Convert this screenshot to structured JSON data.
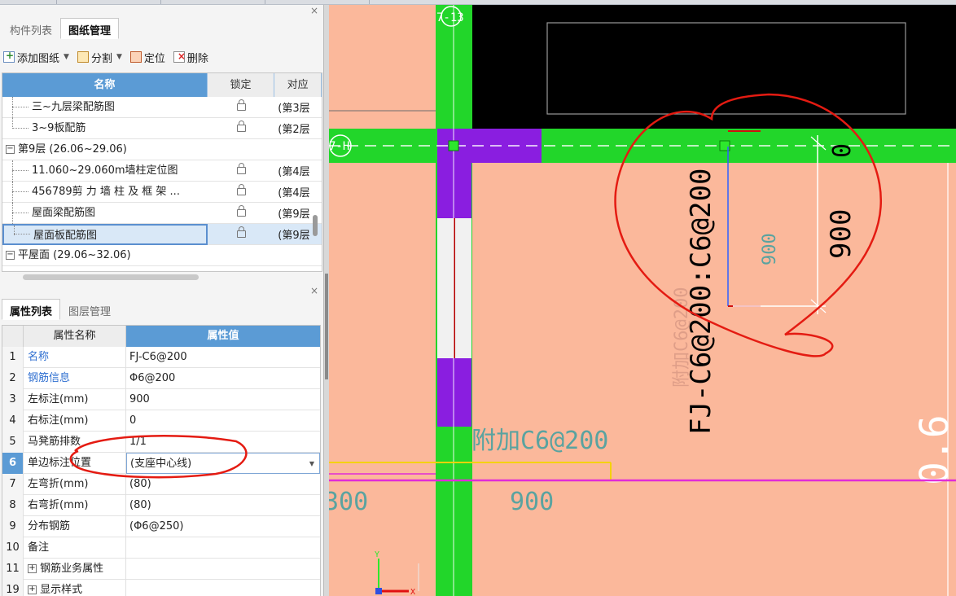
{
  "panel_top": {
    "tabs": [
      "构件列表",
      "图纸管理"
    ],
    "active_tab": 1,
    "close": "×",
    "toolbar": {
      "add_drawing": "添加图纸",
      "split": "分割",
      "locate": "定位",
      "delete": "删除"
    },
    "table": {
      "headers": {
        "name": "名称",
        "lock": "锁定",
        "corr": "对应"
      },
      "rows": [
        {
          "name": "三~九层梁配筋图",
          "corr": "(第3层"
        },
        {
          "name": "3~9板配筋",
          "corr": "(第2层"
        },
        {
          "name": "第9层 (26.06~29.06)",
          "group_toggle": "−"
        },
        {
          "name": "11.060~29.060m墙柱定位图",
          "corr": "(第4层"
        },
        {
          "name": "456789剪 力 墙 柱 及 框 架 ...",
          "corr": "(第4层"
        },
        {
          "name": "屋面梁配筋图",
          "corr": "(第9层"
        },
        {
          "name": "屋面板配筋图",
          "corr": "(第9层"
        },
        {
          "name": "平屋面 (29.06~32.06)",
          "group_toggle": "−"
        }
      ]
    }
  },
  "panel_bottom": {
    "tabs": [
      "属性列表",
      "图层管理"
    ],
    "active_tab": 0,
    "close": "×",
    "headers": {
      "name": "属性名称",
      "value": "属性值"
    },
    "rows": [
      {
        "num": "1",
        "name": "名称",
        "value": "FJ-C6@200"
      },
      {
        "num": "2",
        "name": "钢筋信息",
        "value": "Φ6@200"
      },
      {
        "num": "3",
        "name": "左标注(mm)",
        "value": "900"
      },
      {
        "num": "4",
        "name": "右标注(mm)",
        "value": "0"
      },
      {
        "num": "5",
        "name": "马凳筋排数",
        "value": "1/1"
      },
      {
        "num": "6",
        "name": "单边标注位置",
        "value": "(支座中心线)"
      },
      {
        "num": "7",
        "name": "左弯折(mm)",
        "value": "(80)"
      },
      {
        "num": "8",
        "name": "右弯折(mm)",
        "value": "(80)"
      },
      {
        "num": "9",
        "name": "分布钢筋",
        "value": "(Φ6@250)"
      },
      {
        "num": "10",
        "name": "备注",
        "value": ""
      },
      {
        "num": "11",
        "name": "钢筋业务属性",
        "value": "",
        "expander": "+"
      },
      {
        "num": "19",
        "name": "显示样式",
        "value": "",
        "expander": "+"
      }
    ]
  },
  "canvas": {
    "axis_label_1": "7-13",
    "axis_label_2": "7-H",
    "rebar_label_vertical": "FJ-C6@200:C6@200",
    "rebar_label_faint": "附加C6@200",
    "rebar_label_horizontal": "附加C6@200",
    "dim_900_large": "900",
    "dim_900_small": "900",
    "dim_0": "0",
    "bottom_900": "900",
    "bottom_300": "300",
    "right_text": "0.6",
    "ucs_y": "Y",
    "ucs_x": "X"
  },
  "colors": {
    "slab": "#fbb89b",
    "beam": "#22d62a",
    "column": "#8a1ee0",
    "background": "#000000",
    "annotation": "#ff0000",
    "accent": "#5b9bd5"
  }
}
